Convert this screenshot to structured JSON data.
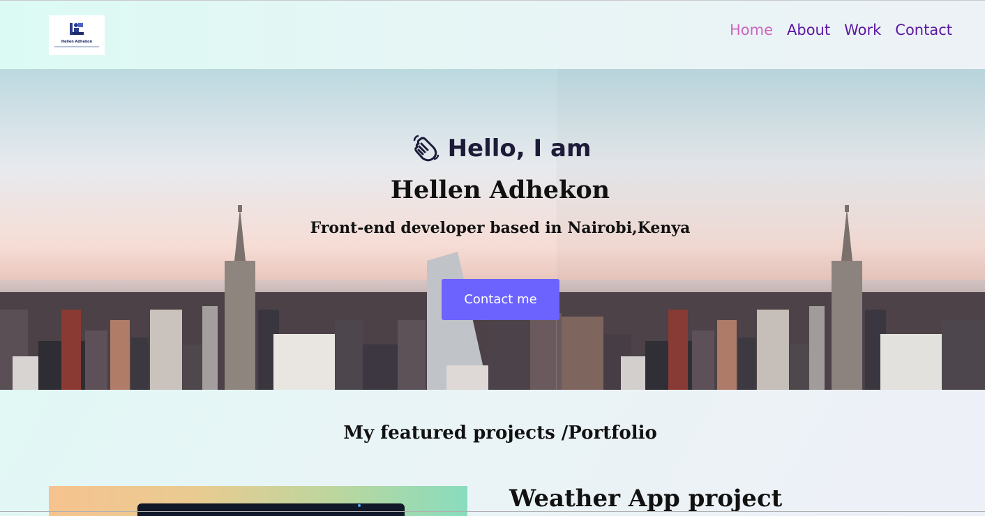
{
  "header": {
    "logo": {
      "name_text": "Hellen Adhekon",
      "icon": "desk-person-logo-icon"
    },
    "nav": [
      {
        "label": "Home",
        "active": true
      },
      {
        "label": "About",
        "active": false
      },
      {
        "label": "Work",
        "active": false
      },
      {
        "label": "Contact",
        "active": false
      }
    ]
  },
  "hero": {
    "greeting_icon": "waving-hand-icon",
    "greeting": "Hello, I am",
    "name": "Hellen Adhekon",
    "role": "Front-end developer based in Nairobi,Kenya",
    "cta_label": "Contact me"
  },
  "portfolio": {
    "title": "My featured projects /Portfolio",
    "projects": [
      {
        "title": "Weather App project"
      }
    ]
  },
  "colors": {
    "nav_text": "#5b17a1",
    "nav_active": "#cc66bb",
    "cta_background": "#6c63ff",
    "heading_text": "#111111"
  }
}
